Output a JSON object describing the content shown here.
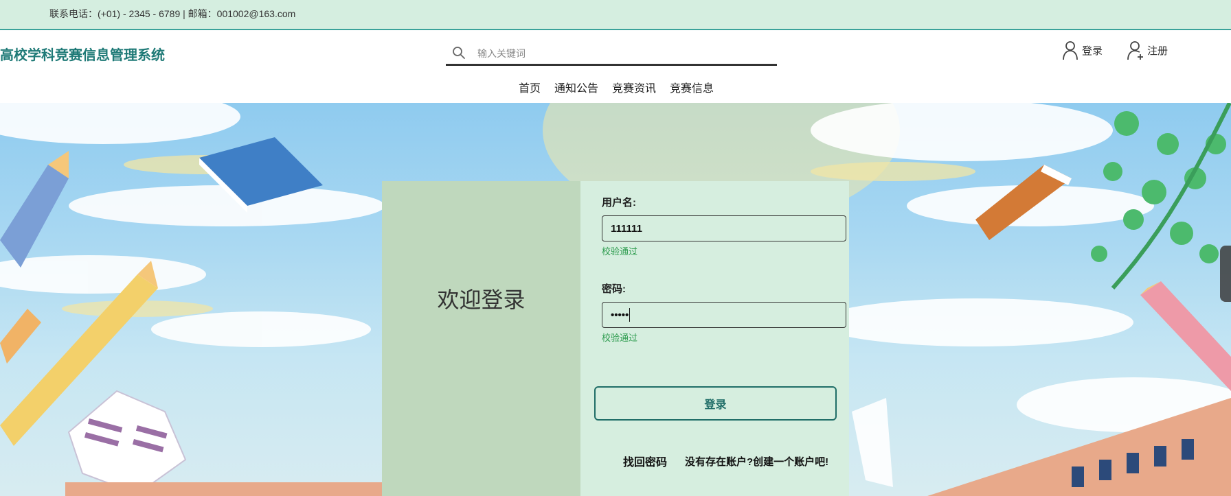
{
  "topbar": {
    "contact": "联系电话：(+01) - 2345 - 6789 | 邮箱：001002@163.com"
  },
  "header": {
    "site_title": "高校学科竞赛信息管理系统",
    "search": {
      "placeholder": "输入关键词",
      "value": ""
    },
    "login_label": "登录",
    "register_label": "注册"
  },
  "nav": {
    "items": [
      "首页",
      "通知公告",
      "竞赛资讯",
      "竞赛信息"
    ]
  },
  "login_card": {
    "welcome": "欢迎登录",
    "username_label": "用户名:",
    "username_value": "111111",
    "username_status": "校验通过",
    "password_label": "密码:",
    "password_value": "•••••",
    "password_status": "校验通过",
    "submit_label": "登录",
    "forgot_label": "找回密码",
    "create_label": "没有存在账户?创建一个账户吧!"
  },
  "colors": {
    "topbar_bg": "#d5eee0",
    "brand": "#1f7a77",
    "card_left": "#bfd8bd",
    "card_right": "#d6eedf",
    "success": "#2e9c4f"
  }
}
